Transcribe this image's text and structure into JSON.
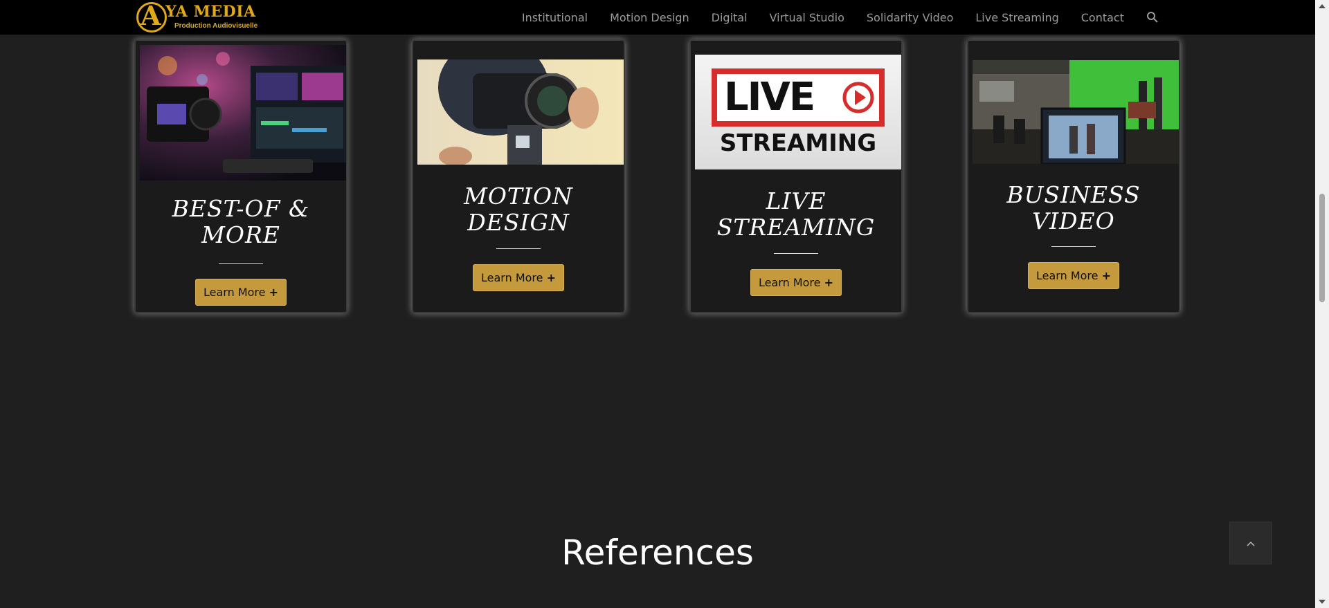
{
  "header": {
    "logo": {
      "letter": "A",
      "name": "YA MEDIA",
      "subtitle": "Production Audiovisuelle"
    },
    "nav": [
      "Institutional",
      "Motion Design",
      "Digital",
      "Virtual Studio",
      "Solidarity Video",
      "Live Streaming",
      "Contact"
    ],
    "search_icon": "search-icon"
  },
  "cards": [
    {
      "title_line1": "BEST-OF &",
      "title_line2": "MORE",
      "button": "Learn More",
      "button_plus": "+",
      "image": "camera-and-editing-monitor"
    },
    {
      "title_line1": "MOTION",
      "title_line2": "DESIGN",
      "button": "Learn More",
      "button_plus": "+",
      "image": "camera-operator"
    },
    {
      "title_line1": "LIVE",
      "title_line2": "STREAMING",
      "button": "Learn More",
      "button_plus": "+",
      "image": "live-streaming-sign",
      "image_text": {
        "live": "LIVE",
        "streaming": "STREAMING"
      }
    },
    {
      "title_line1": "BUSINESS",
      "title_line2": "VIDEO",
      "button": "Learn More",
      "button_plus": "+",
      "image": "green-screen-studio"
    }
  ],
  "section_heading": "References",
  "to_top_icon": "chevron-up-icon",
  "colors": {
    "accent": "#c49a3c",
    "logo": "#e1a917",
    "background": "#1f1f1f",
    "header": "#000000",
    "live_red": "#d62c2c"
  }
}
